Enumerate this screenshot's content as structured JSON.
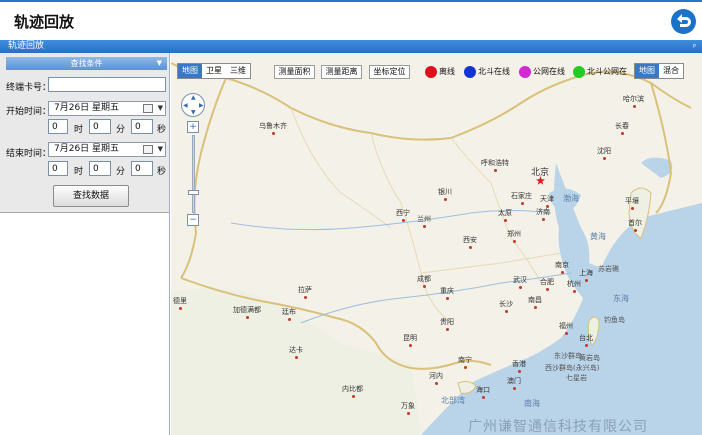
{
  "header": {
    "title": "轨迹回放"
  },
  "bar": {
    "label": "轨迹回放",
    "pin": "ᵖ"
  },
  "query": {
    "section_title": "查找条件",
    "terminal_label": "终端卡号：",
    "terminal_value": "",
    "start_label": "开始时间：",
    "start_date": "7月26日 星期五",
    "start_h": "0",
    "start_m": "0",
    "start_s": "0",
    "end_label": "结束时间：",
    "end_date": "7月26日 星期五",
    "end_h": "0",
    "end_m": "0",
    "end_s": "0",
    "unit_h": "时",
    "unit_m": "分",
    "unit_s": "秒",
    "button": "查找数据"
  },
  "map": {
    "type_tabs": [
      "地图",
      "卫星",
      "三维"
    ],
    "tools": [
      "测量面积",
      "测量距离",
      "坐标定位"
    ],
    "legend": [
      {
        "label": "离线",
        "color": "#e0101a"
      },
      {
        "label": "北斗在线",
        "color": "#1434d0"
      },
      {
        "label": "公网在线",
        "color": "#d428d0"
      },
      {
        "label": "北斗公网在",
        "color": "#22cc22"
      }
    ],
    "right_tabs": [
      "地图",
      "混合"
    ],
    "zoom_in": "+",
    "zoom_out": "−",
    "cities": [
      "乌鲁木齐",
      "哈尔滨",
      "长春",
      "沈阳",
      "呼和浩特",
      "北京",
      "天津",
      "石家庄",
      "银川",
      "太原",
      "济南",
      "西宁",
      "兰州",
      "郑州",
      "西安",
      "南京",
      "上海",
      "合肥",
      "杭州",
      "成都",
      "重庆",
      "武汉",
      "长沙",
      "南昌",
      "拉萨",
      "贵阳",
      "昆明",
      "福州",
      "台北",
      "南宁",
      "香港",
      "澳门",
      "海口",
      "加德满都",
      "廷布",
      "达卡",
      "内比都",
      "河内",
      "平壤",
      "首尔",
      "万象",
      "德里"
    ],
    "waters": [
      "渤海",
      "黄海",
      "东海",
      "北部湾",
      "南海",
      "苏岩礁",
      "钓鱼岛",
      "东沙群岛",
      "黄岩岛",
      "西沙群岛(永兴岛)",
      "七星岩"
    ],
    "watermark": "广州谦智通信科技有限公司"
  }
}
